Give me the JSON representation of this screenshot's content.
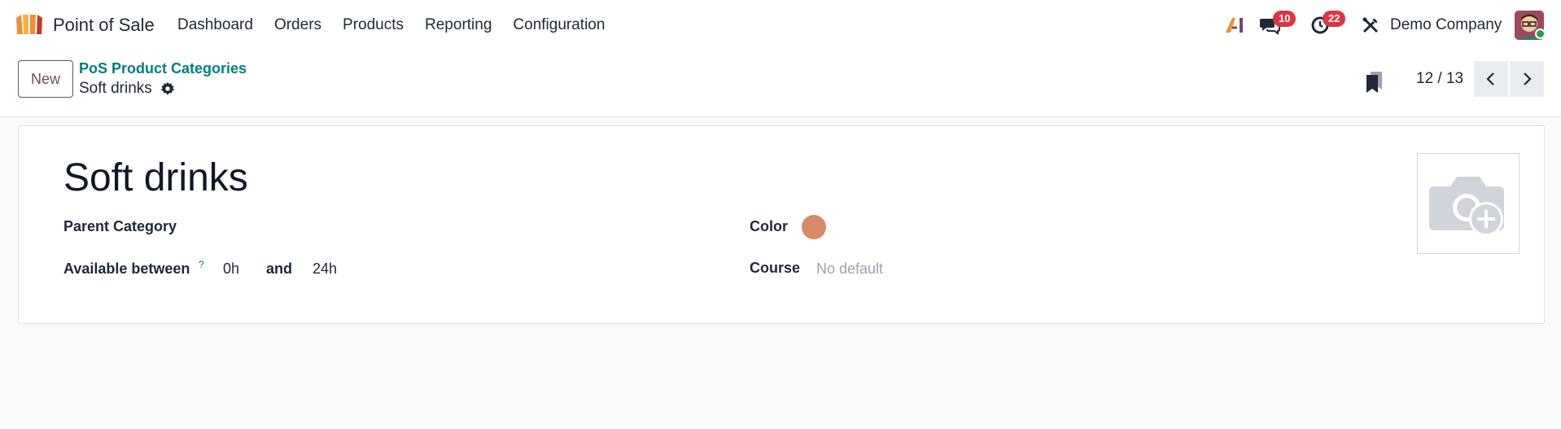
{
  "navbar": {
    "app_name": "Point of Sale",
    "menu": [
      "Dashboard",
      "Orders",
      "Products",
      "Reporting",
      "Configuration"
    ],
    "messages_count": "10",
    "activities_count": "22",
    "company": "Demo Company"
  },
  "control": {
    "new_label": "New",
    "breadcrumb": "PoS Product Categories",
    "record_title": "Soft drinks",
    "pager": "12 / 13"
  },
  "form": {
    "name": "Soft drinks",
    "parent_category_label": "Parent Category",
    "available_between_label": "Available between",
    "help_mark": "?",
    "start_hour": "0h",
    "and_label": "and",
    "end_hour": "24h",
    "color_label": "Color",
    "color_value": "#d98a67",
    "course_label": "Course",
    "course_placeholder": "No default"
  },
  "colors": {
    "brand": "#714b67",
    "link": "#017e84",
    "badge": "#dc3545",
    "online": "#22a247"
  }
}
